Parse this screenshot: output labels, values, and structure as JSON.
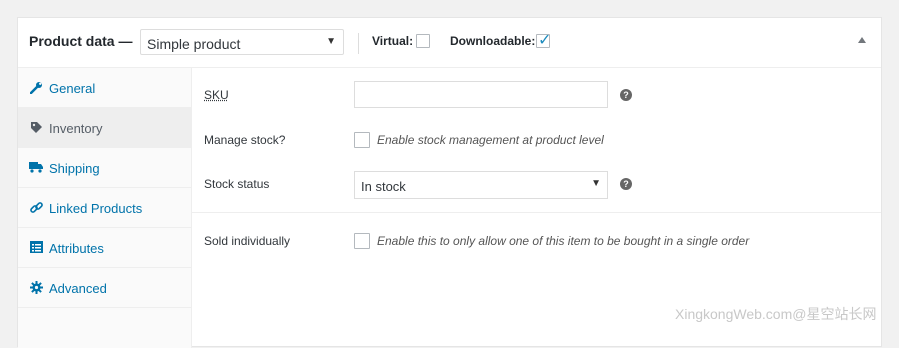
{
  "header": {
    "title": "Product data —",
    "product_type": "Simple product",
    "virtual_label": "Virtual:",
    "downloadable_label": "Downloadable:",
    "virtual_checked": false,
    "downloadable_checked": true
  },
  "tabs": [
    {
      "label": "General",
      "icon": "wrench-icon"
    },
    {
      "label": "Inventory",
      "icon": "tag-icon",
      "active": true
    },
    {
      "label": "Shipping",
      "icon": "truck-icon"
    },
    {
      "label": "Linked Products",
      "icon": "link-icon"
    },
    {
      "label": "Attributes",
      "icon": "list-icon"
    },
    {
      "label": "Advanced",
      "icon": "gear-icon"
    }
  ],
  "inventory": {
    "sku_label": "SKU",
    "sku_value": "",
    "manage_stock_label": "Manage stock?",
    "manage_stock_text": "Enable stock management at product level",
    "stock_status_label": "Stock status",
    "stock_status_value": "In stock",
    "sold_individually_label": "Sold individually",
    "sold_individually_text": "Enable this to only allow one of this item to be bought in a single order"
  },
  "watermark": "XingkongWeb.com@星空站长网",
  "colors": {
    "link": "#0073aa",
    "checkbox_tick": "#1e8cbe"
  }
}
